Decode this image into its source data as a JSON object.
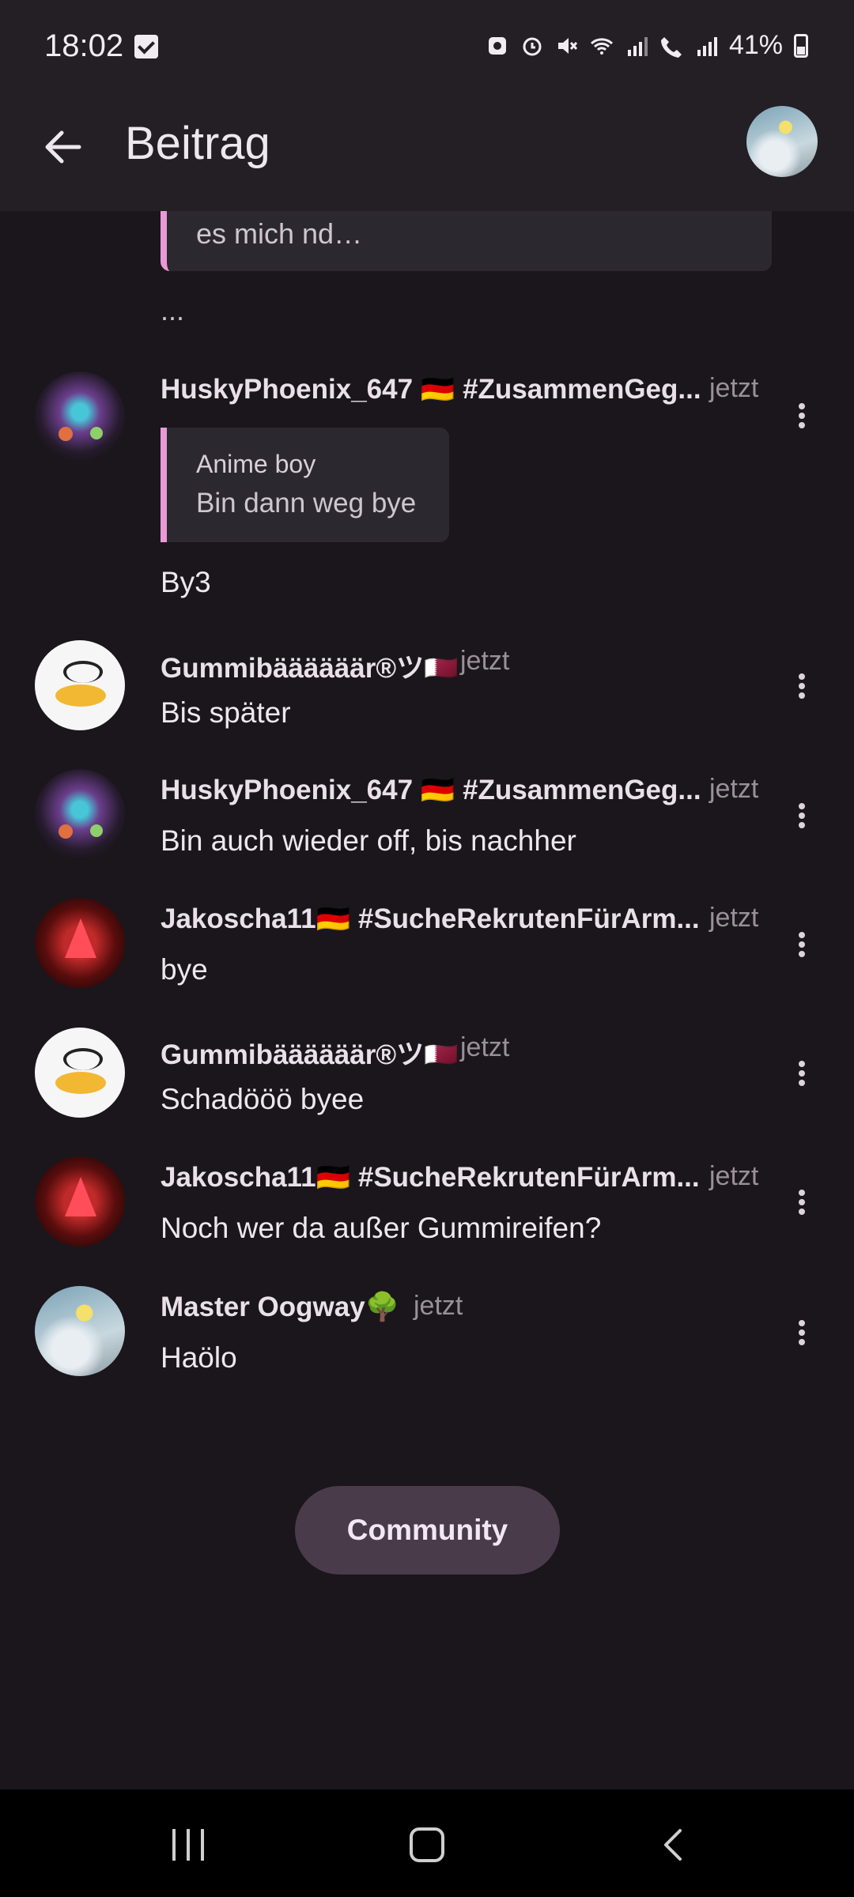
{
  "status_bar": {
    "time": "18:02",
    "battery": "41%",
    "icons": [
      "check-notification-icon",
      "recycle-icon",
      "alarm-icon",
      "mute-icon",
      "wifi-icon",
      "signal-icon",
      "wifi-call-icon",
      "signal2-icon",
      "battery-icon"
    ]
  },
  "app_bar": {
    "title": "Beitrag",
    "back_icon": "arrow-left-icon"
  },
  "top_quote": {
    "text": "es mich nd…",
    "after_text": "..."
  },
  "messages": [
    {
      "username": "HuskyPhoenix_647 🇩🇪 #ZusammenGeg...",
      "time": "jetzt",
      "reply_to": {
        "name": "Anime boy",
        "text": "Bin dann weg bye"
      },
      "text": "By3"
    },
    {
      "username": "Gummibäääääär®ツ🇶🇦",
      "time": "jetzt",
      "text": "Bis später"
    },
    {
      "username": "HuskyPhoenix_647 🇩🇪 #ZusammenGeg...",
      "time": "jetzt",
      "text": "Bin auch wieder off, bis nachher"
    },
    {
      "username": "Jakoscha11🇩🇪 #SucheRekrutenFürArm...",
      "time": "jetzt",
      "text": "bye"
    },
    {
      "username": "Gummibäääääär®ツ🇶🇦",
      "time": "jetzt",
      "text": "Schadööö byee"
    },
    {
      "username": "Jakoscha11🇩🇪 #SucheRekrutenFürArm...",
      "time": "jetzt",
      "text": "Noch wer da außer Gummireifen?"
    },
    {
      "username": "Master Oogway🌳",
      "time": "jetzt",
      "text": "Haölo"
    }
  ],
  "community_button": "Community",
  "colors": {
    "background": "#1a161c",
    "quote_accent": "#e99ad6",
    "button_bg": "#4a3b4a"
  }
}
